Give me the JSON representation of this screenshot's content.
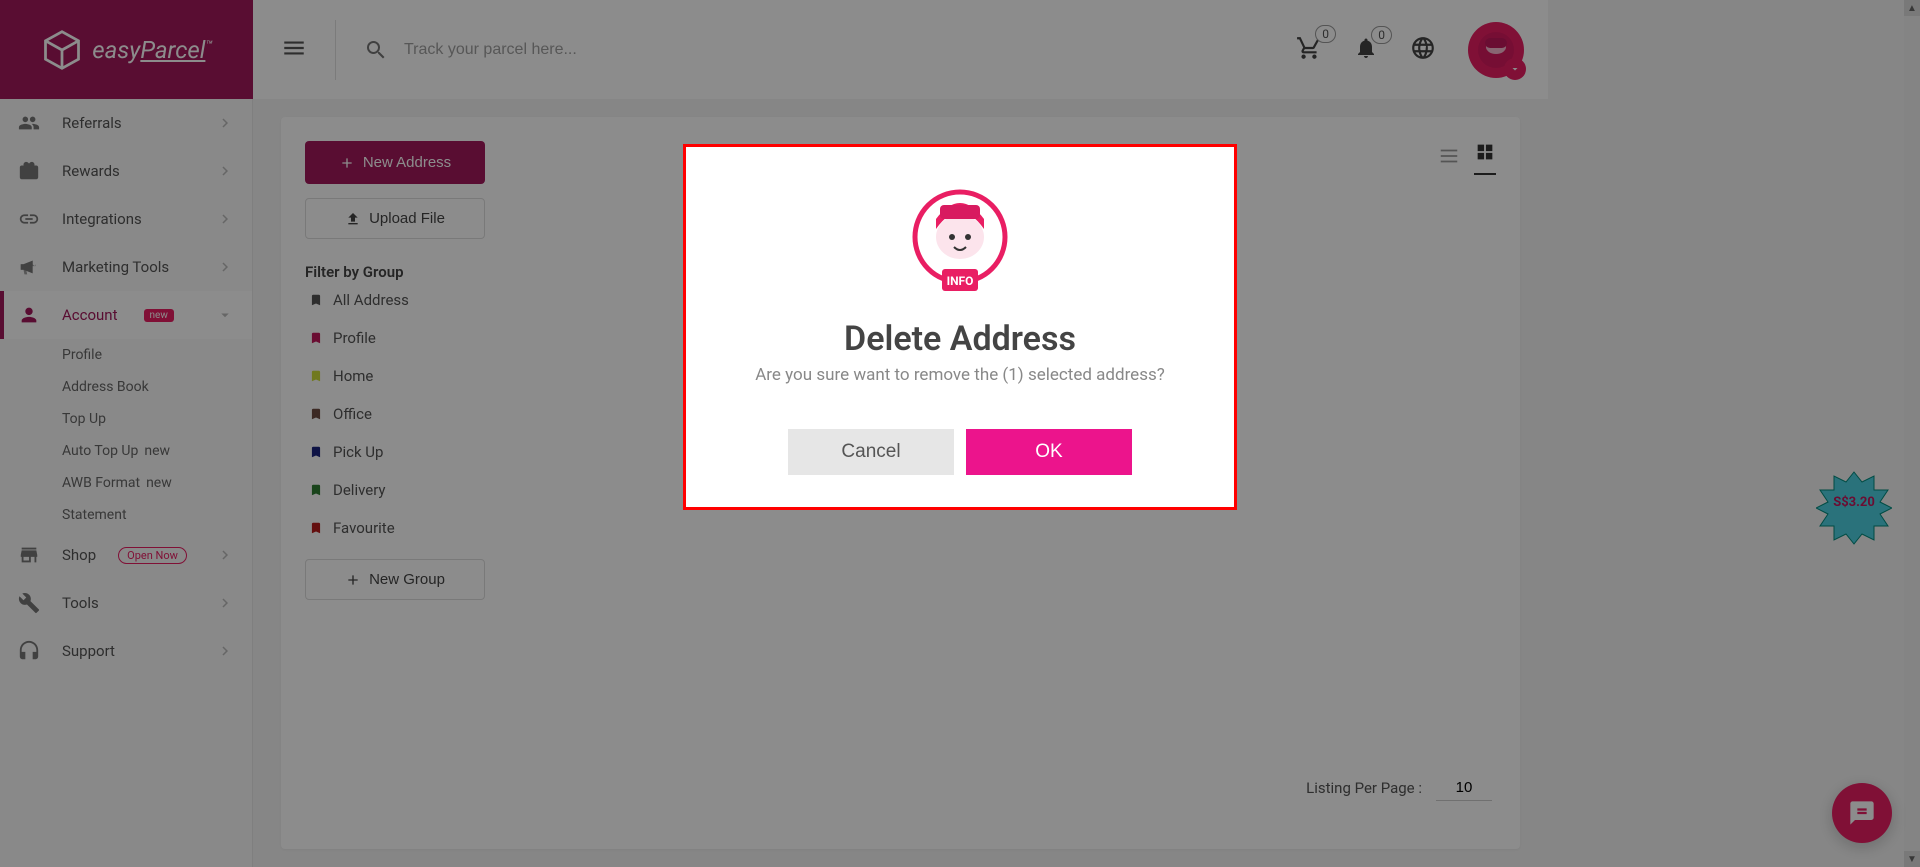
{
  "brand": {
    "name": "easyParcel"
  },
  "header": {
    "search_placeholder": "Track your parcel here...",
    "cart_count": "0",
    "notif_count": "0"
  },
  "sidebar": {
    "items": [
      {
        "label": "Referrals",
        "icon": "referrals",
        "new": false
      },
      {
        "label": "Rewards",
        "icon": "gift",
        "new": false
      },
      {
        "label": "Integrations",
        "icon": "link",
        "new": false
      },
      {
        "label": "Marketing Tools",
        "icon": "megaphone",
        "new": false
      },
      {
        "label": "Account",
        "icon": "person",
        "new": true,
        "active": true
      },
      {
        "label": "Shop",
        "icon": "store",
        "open_now": true
      },
      {
        "label": "Tools",
        "icon": "wrench",
        "new": false
      },
      {
        "label": "Support",
        "icon": "headset",
        "new": false
      }
    ],
    "account_sub": [
      {
        "label": "Profile"
      },
      {
        "label": "Address Book"
      },
      {
        "label": "Top Up"
      },
      {
        "label": "Auto Top Up",
        "new": true
      },
      {
        "label": "AWB Format",
        "new": true
      },
      {
        "label": "Statement"
      }
    ],
    "open_now_label": "Open Now",
    "new_label": "new"
  },
  "content": {
    "new_address": "New Address",
    "upload_file": "Upload File",
    "filter_title": "Filter by Group",
    "groups": [
      {
        "label": "All Address",
        "color": "#555"
      },
      {
        "label": "Profile",
        "color": "#c2185b"
      },
      {
        "label": "Home",
        "color": "#cddc39"
      },
      {
        "label": "Office",
        "color": "#6d4c41"
      },
      {
        "label": "Pick Up",
        "color": "#1a237e"
      },
      {
        "label": "Delivery",
        "color": "#2e7d32"
      },
      {
        "label": "Favourite",
        "color": "#b71c1c"
      }
    ],
    "new_group": "New Group",
    "listing_label": "Listing Per Page :",
    "listing_value": "10"
  },
  "modal": {
    "title": "Delete Address",
    "message": "Are you sure want to remove the (1) selected address?",
    "cancel": "Cancel",
    "ok": "OK",
    "info_label": "INFO"
  },
  "floating": {
    "price_text": "S$3.20"
  }
}
